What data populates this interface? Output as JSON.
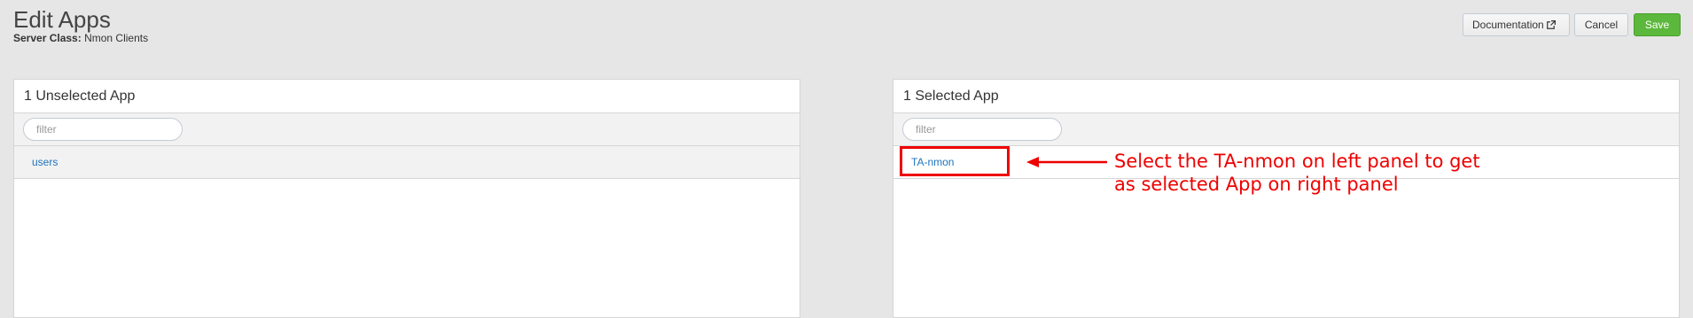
{
  "header": {
    "title": "Edit Apps",
    "server_class_label": "Server Class:",
    "server_class_value": "Nmon Clients"
  },
  "toolbar": {
    "documentation_label": "Documentation",
    "cancel_label": "Cancel",
    "save_label": "Save"
  },
  "left_panel": {
    "title": "1 Unselected App",
    "filter_placeholder": "filter",
    "items": [
      {
        "label": "users"
      }
    ]
  },
  "right_panel": {
    "title": "1 Selected App",
    "filter_placeholder": "filter",
    "items": [
      {
        "label": "TA-nmon"
      }
    ]
  },
  "annotation": {
    "line1": "Select the TA-nmon on left panel to get",
    "line2": "as selected App on right panel",
    "color": "#ee0000"
  },
  "colors": {
    "save_button": "#5cb83c",
    "link": "#1e73be",
    "background": "#e6e6e6"
  }
}
